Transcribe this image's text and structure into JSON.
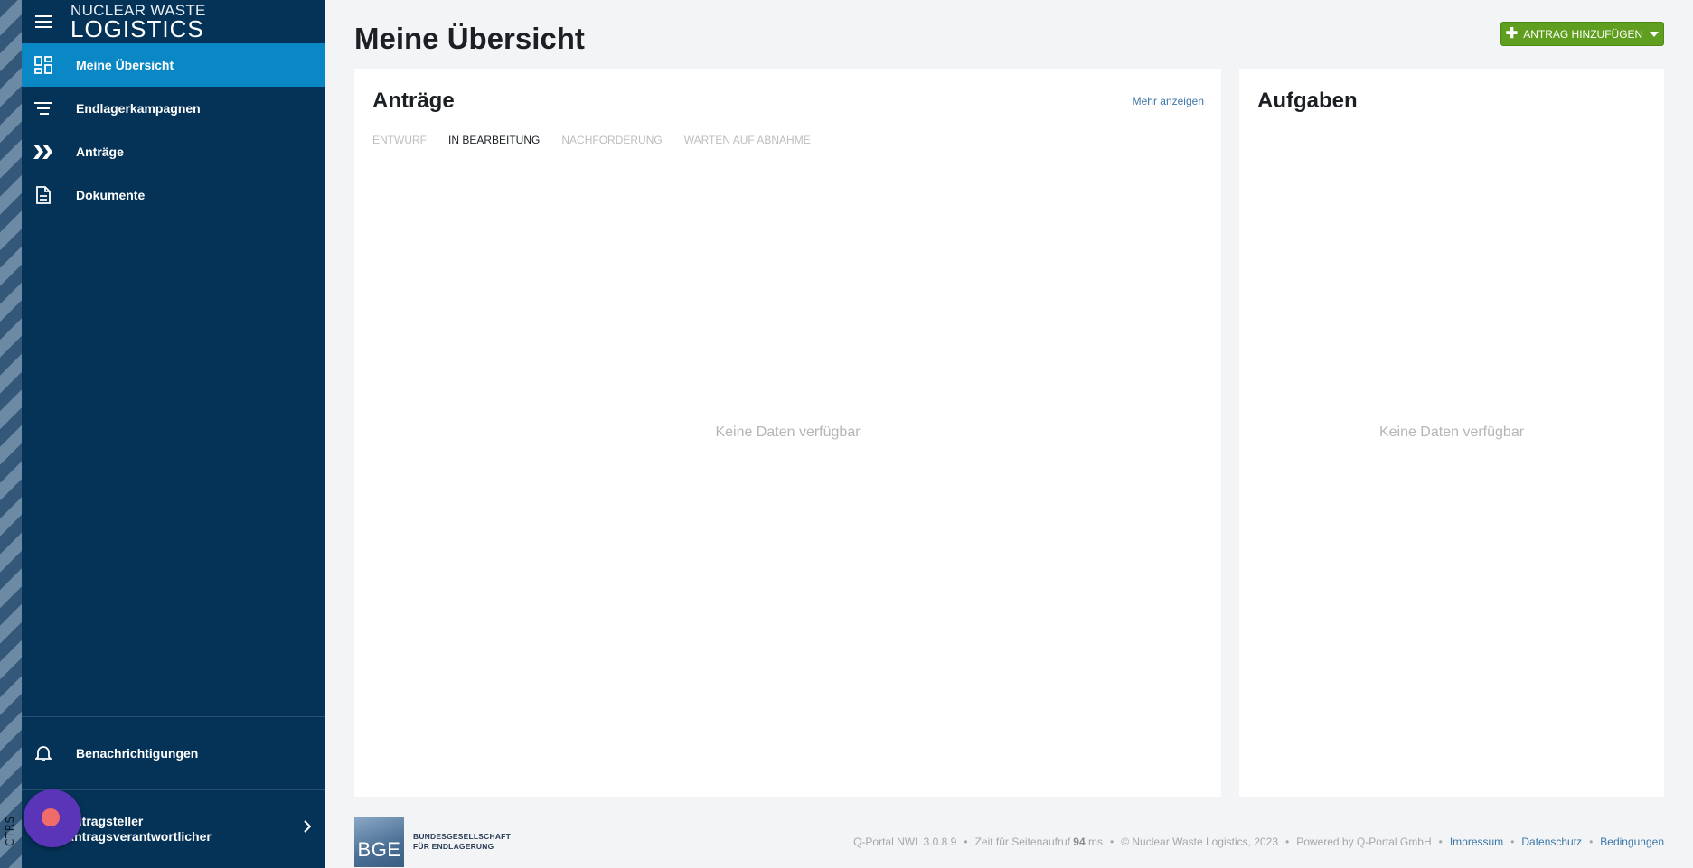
{
  "env": {
    "label": "CTRS"
  },
  "brand": {
    "line1": "NUCLEAR WASTE",
    "line2": "LOGISTICS"
  },
  "sidebar": {
    "items": [
      {
        "label": "Meine Übersicht",
        "icon": "dashboard-icon",
        "active": true
      },
      {
        "label": "Endlagerkampagnen",
        "icon": "campaign-list-icon",
        "active": false
      },
      {
        "label": "Anträge",
        "icon": "double-chevron-icon",
        "active": false
      },
      {
        "label": "Dokumente",
        "icon": "document-icon",
        "active": false
      }
    ],
    "notifications_label": "Benachrichtigungen",
    "user": {
      "line1": "Antragsteller",
      "line2": "Antragsverantwortlicher"
    }
  },
  "header": {
    "title": "Meine Übersicht",
    "add_button_label": "ANTRAG HINZUFÜGEN"
  },
  "antraege": {
    "title": "Anträge",
    "more_label": "Mehr anzeigen",
    "tabs": [
      {
        "label": "ENTWURF",
        "active": false
      },
      {
        "label": "IN BEARBEITUNG",
        "active": true
      },
      {
        "label": "NACHFORDERUNG",
        "active": false
      },
      {
        "label": "WARTEN AUF ABNAHME",
        "active": false
      }
    ],
    "empty_text": "Keine Daten verfügbar"
  },
  "aufgaben": {
    "title": "Aufgaben",
    "empty_text": "Keine Daten verfügbar"
  },
  "footer": {
    "logo_letters": "BGE",
    "logo_line1": "BUNDESGESELLSCHAFT",
    "logo_line2": "FÜR ENDLAGERUNG",
    "version": "Q-Portal NWL 3.0.8.9",
    "load_time_prefix": "Zeit für Seitenaufruf",
    "load_time_value": "94",
    "load_time_unit": "ms",
    "copyright": "© Nuclear Waste Logistics, 2023",
    "powered_by": "Powered by Q-Portal GmbH",
    "links": [
      "Impressum",
      "Datenschutz",
      "Bedingungen"
    ]
  },
  "colors": {
    "sidebar_bg": "#053357",
    "active_item": "#0a88c6",
    "add_button": "#5f9e1e",
    "link": "#3a76a8"
  }
}
